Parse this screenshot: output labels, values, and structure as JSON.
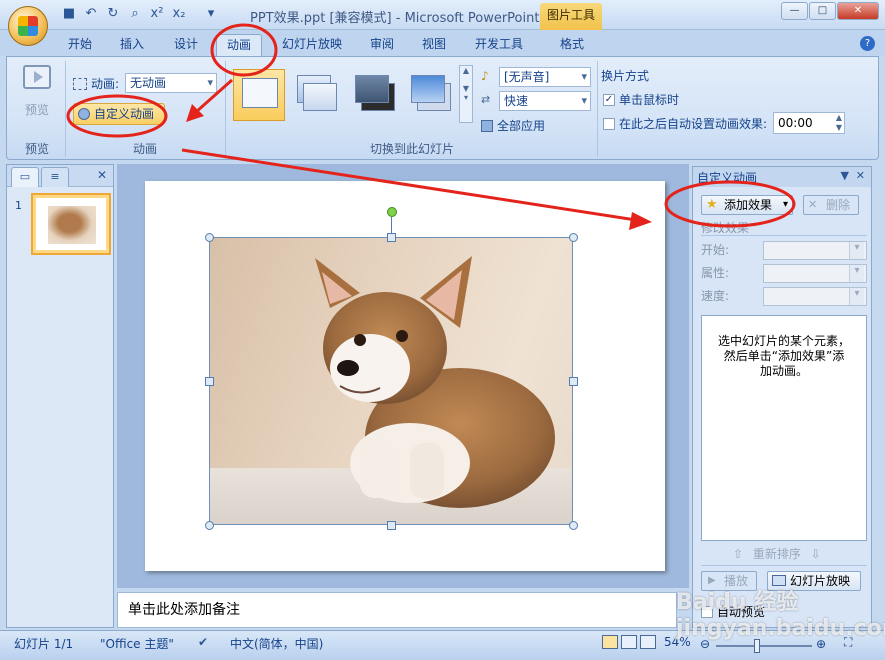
{
  "title": "PPT效果.ppt [兼容模式] - Microsoft PowerPoint",
  "contextual_tab": "图片工具",
  "window_buttons": {
    "minimize": "—",
    "maximize": "□",
    "close": "✕"
  },
  "tabs": [
    "开始",
    "插入",
    "设计",
    "动画",
    "幻灯片放映",
    "审阅",
    "视图",
    "开发工具",
    "格式"
  ],
  "active_tab": "动画",
  "help": "?",
  "ribbon": {
    "preview_label": "预览",
    "preview_group": "预览",
    "animation_label": "动画:",
    "animation_value": "无动画",
    "custom_animation": "自定义动画",
    "animation_group": "动画",
    "sound_value": "[无声音]",
    "speed_value": "快速",
    "apply_all": "全部应用",
    "transition_group": "切换到此幻灯片",
    "advance_title": "换片方式",
    "on_click": "单击鼠标时",
    "auto_after": "在此之后自动设置动画效果:",
    "auto_time": "00:00"
  },
  "left_pane": {
    "close": "✕",
    "slide_number": "1"
  },
  "notes_placeholder": "单击此处添加备注",
  "task_pane": {
    "title": "自定义动画",
    "add_effect": "添加效果",
    "remove": "删除",
    "modify_label": "修改效果",
    "start_label": "开始:",
    "property_label": "属性:",
    "speed_label": "速度:",
    "hint": "选中幻灯片的某个元素，\n然后单击“添加效果”添\n加动画。",
    "reorder": "重新排序",
    "play": "播放",
    "slideshow": "幻灯片放映",
    "autopreview": "自动预览"
  },
  "status": {
    "slide": "幻灯片 1/1",
    "theme": "\"Office 主题\"",
    "language": "中文(简体，中国)",
    "zoom": "54%"
  },
  "watermark": "Baidu 经验 jingyan.baidu.com",
  "colors": {
    "accent": "#15428b",
    "annotation": "#e4241b",
    "highlight": "#f9cf65"
  }
}
